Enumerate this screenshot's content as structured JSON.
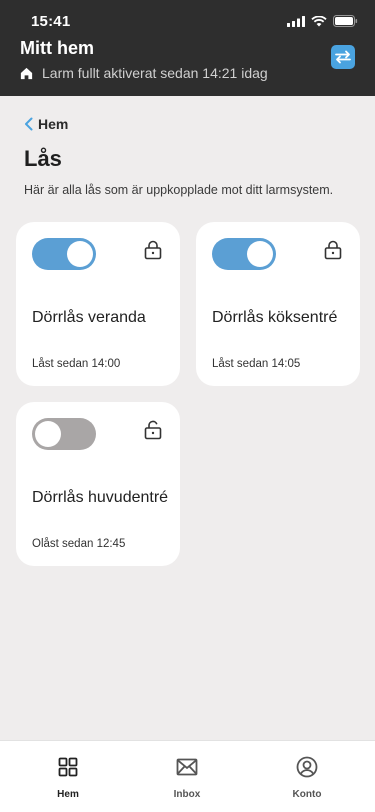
{
  "status_bar": {
    "time": "15:41"
  },
  "header": {
    "title": "Mitt hem",
    "alarm_status": "Larm fullt aktiverat sedan 14:21 idag"
  },
  "nav": {
    "back_label": "Hem"
  },
  "page": {
    "title": "Lås",
    "description": "Här är alla lås som är uppkopplade mot ditt larmsystem."
  },
  "locks": [
    {
      "name": "Dörrlås veranda",
      "status": "Låst sedan 14:00",
      "locked": true
    },
    {
      "name": "Dörrlås köksentré",
      "status": "Låst sedan 14:05",
      "locked": true
    },
    {
      "name": "Dörrlås huvudentré",
      "status": "Olåst sedan 12:45",
      "locked": false
    }
  ],
  "tabbar": {
    "tabs": [
      {
        "label": "Hem",
        "icon": "grid-icon",
        "active": true
      },
      {
        "label": "Inbox",
        "icon": "envelope-icon",
        "active": false
      },
      {
        "label": "Konto",
        "icon": "account-icon",
        "active": false
      }
    ]
  },
  "colors": {
    "header_bg": "#2e2e2e",
    "toggle_on": "#5b9fd4",
    "toggle_off": "#a9a6a6",
    "accent": "#4aa3e0"
  }
}
